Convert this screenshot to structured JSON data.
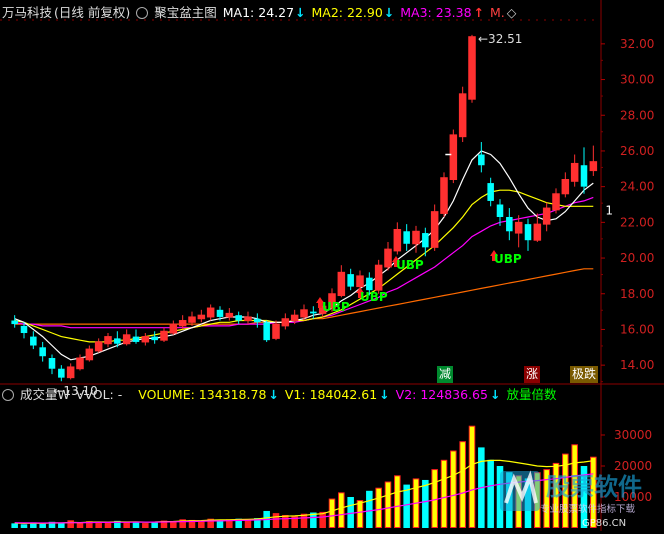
{
  "main_header": {
    "stock_name": "万马科技",
    "period": "(日线 前复权)",
    "indicator_name": "聚宝盆主图",
    "ma1_label": "MA1: 24.27",
    "ma2_label": "MA2: 22.90",
    "ma3_label": "MA3: 23.38",
    "m_label": "M.",
    "arrow_down": "↓",
    "arrow_up": "↑",
    "diamond": "◇",
    "colors": {
      "ma1": "#ffffff",
      "ma2": "#ffff00",
      "ma3": "#ff00ff",
      "m": "#ff4040"
    }
  },
  "volume_header": {
    "name": "成交量W",
    "vvol": "VVOL: -",
    "volume_label": "VOLUME: 134318.78",
    "v1_label": "V1: 184042.61",
    "v2_label": "V2: 124836.65",
    "extra": "放量倍数"
  },
  "annotations": {
    "high": "32.51",
    "low": "13.10",
    "arrow_left": "←",
    "dash": "1"
  },
  "signals": [
    "UBP",
    "UBP",
    "UBP",
    "UBP"
  ],
  "bar_labels": {
    "jian": "减",
    "zhang": "涨",
    "die": "极跌"
  },
  "watermark": {
    "title": "股票软件",
    "sub": "专业股票软件指标下载",
    "site": "GP86.CN"
  },
  "chart_data": {
    "type": "candlestick",
    "y_axis_ticks": [
      "32.00",
      "30.00",
      "28.00",
      "26.00",
      "24.00",
      "22.00",
      "20.00",
      "18.00",
      "16.00",
      "14.00"
    ],
    "ylim": [
      13.0,
      33.0
    ],
    "volume_ticks": [
      "30000",
      "20000",
      "10000"
    ],
    "volume_ylim": [
      0,
      40000
    ],
    "candles": [
      [
        16.5,
        16.3,
        16.8,
        16.1
      ],
      [
        16.2,
        15.8,
        16.4,
        15.5
      ],
      [
        15.6,
        15.1,
        15.9,
        14.9
      ],
      [
        15.0,
        14.5,
        15.3,
        14.2
      ],
      [
        14.4,
        13.8,
        14.6,
        13.5
      ],
      [
        13.8,
        13.3,
        14.0,
        13.1
      ],
      [
        13.3,
        13.9,
        14.1,
        13.2
      ],
      [
        13.8,
        14.4,
        14.6,
        13.7
      ],
      [
        14.3,
        14.9,
        15.1,
        14.2
      ],
      [
        14.8,
        15.3,
        15.5,
        14.7
      ],
      [
        15.2,
        15.6,
        15.8,
        15.0
      ],
      [
        15.5,
        15.2,
        15.9,
        15.0
      ],
      [
        15.2,
        15.7,
        16.0,
        15.1
      ],
      [
        15.6,
        15.3,
        16.0,
        15.2
      ],
      [
        15.3,
        15.6,
        15.8,
        15.1
      ],
      [
        15.6,
        15.4,
        15.9,
        15.2
      ],
      [
        15.4,
        15.9,
        16.1,
        15.3
      ],
      [
        15.8,
        16.3,
        16.5,
        15.7
      ],
      [
        16.2,
        16.5,
        16.8,
        16.0
      ],
      [
        16.4,
        16.7,
        17.0,
        16.2
      ],
      [
        16.6,
        16.8,
        17.1,
        16.4
      ],
      [
        16.7,
        17.2,
        17.4,
        16.5
      ],
      [
        17.1,
        16.7,
        17.3,
        16.5
      ],
      [
        16.7,
        16.9,
        17.2,
        16.5
      ],
      [
        16.8,
        16.5,
        17.0,
        16.3
      ],
      [
        16.5,
        16.7,
        17.0,
        16.3
      ],
      [
        16.6,
        16.4,
        16.9,
        16.1
      ],
      [
        16.4,
        15.4,
        16.5,
        15.3
      ],
      [
        15.5,
        16.3,
        16.5,
        15.4
      ],
      [
        16.2,
        16.6,
        16.9,
        16.0
      ],
      [
        16.5,
        16.8,
        17.1,
        16.3
      ],
      [
        16.7,
        17.1,
        17.4,
        16.5
      ],
      [
        17.0,
        16.9,
        17.3,
        16.6
      ],
      [
        16.9,
        17.3,
        17.6,
        16.7
      ],
      [
        17.2,
        18.0,
        18.3,
        17.0
      ],
      [
        17.9,
        19.2,
        19.6,
        17.8
      ],
      [
        19.1,
        18.4,
        19.4,
        18.2
      ],
      [
        18.4,
        19.0,
        19.3,
        18.1
      ],
      [
        18.9,
        18.2,
        19.2,
        17.9
      ],
      [
        18.2,
        19.6,
        19.9,
        18.0
      ],
      [
        19.5,
        20.5,
        20.9,
        19.3
      ],
      [
        20.4,
        21.6,
        22.0,
        20.2
      ],
      [
        21.5,
        20.8,
        21.9,
        20.4
      ],
      [
        20.8,
        21.5,
        21.8,
        20.3
      ],
      [
        21.4,
        20.6,
        21.7,
        20.1
      ],
      [
        20.6,
        22.6,
        23.0,
        20.4
      ],
      [
        22.5,
        24.5,
        24.8,
        22.3
      ],
      [
        24.4,
        26.9,
        27.2,
        24.2
      ],
      [
        26.8,
        29.2,
        29.6,
        26.5
      ],
      [
        28.9,
        32.4,
        32.5,
        28.7
      ],
      [
        25.8,
        25.2,
        26.5,
        24.8
      ],
      [
        24.2,
        23.2,
        24.5,
        22.9
      ],
      [
        23.0,
        22.3,
        23.3,
        21.8
      ],
      [
        22.3,
        21.5,
        22.8,
        21.0
      ],
      [
        21.4,
        22.0,
        22.4,
        20.6
      ],
      [
        21.9,
        21.0,
        22.2,
        20.4
      ],
      [
        21.0,
        21.9,
        22.5,
        20.9
      ],
      [
        21.9,
        22.8,
        23.1,
        21.5
      ],
      [
        22.7,
        23.6,
        23.9,
        22.5
      ],
      [
        23.6,
        24.4,
        24.8,
        23.4
      ],
      [
        24.3,
        25.3,
        25.8,
        24.0
      ],
      [
        25.2,
        24.0,
        26.2,
        23.6
      ],
      [
        24.9,
        25.4,
        26.3,
        24.6
      ]
    ],
    "ma1": [
      16.6,
      16.4,
      16.0,
      15.6,
      15.1,
      14.6,
      14.3,
      14.4,
      14.5,
      14.7,
      14.9,
      15.1,
      15.3,
      15.4,
      15.5,
      15.5,
      15.6,
      15.7,
      15.9,
      16.1,
      16.3,
      16.5,
      16.6,
      16.7,
      16.7,
      16.7,
      16.6,
      16.4,
      16.4,
      16.4,
      16.5,
      16.6,
      16.8,
      16.9,
      17.2,
      17.6,
      17.9,
      18.3,
      18.6,
      19.0,
      19.4,
      19.9,
      20.3,
      20.7,
      21.1,
      21.6,
      22.3,
      23.2,
      24.4,
      25.5,
      26.0,
      25.8,
      25.3,
      24.5,
      23.6,
      22.8,
      22.3,
      22.1,
      22.2,
      22.6,
      23.2,
      23.8,
      24.2
    ],
    "ma2": [
      16.5,
      16.4,
      16.2,
      16.0,
      15.8,
      15.6,
      15.5,
      15.4,
      15.3,
      15.3,
      15.3,
      15.4,
      15.4,
      15.5,
      15.6,
      15.7,
      15.8,
      15.9,
      16.0,
      16.1,
      16.2,
      16.3,
      16.4,
      16.4,
      16.5,
      16.5,
      16.5,
      16.5,
      16.4,
      16.4,
      16.5,
      16.5,
      16.6,
      16.7,
      16.9,
      17.1,
      17.4,
      17.7,
      18.0,
      18.3,
      18.7,
      19.1,
      19.5,
      19.9,
      20.3,
      20.7,
      21.2,
      21.7,
      22.3,
      23.0,
      23.4,
      23.7,
      23.8,
      23.8,
      23.7,
      23.5,
      23.3,
      23.1,
      23.0,
      22.9,
      22.9,
      22.9,
      22.9
    ],
    "ma3": [
      16.4,
      16.3,
      16.3,
      16.2,
      16.2,
      16.2,
      16.1,
      16.1,
      16.1,
      16.1,
      16.1,
      16.1,
      16.1,
      16.1,
      16.1,
      16.1,
      16.1,
      16.1,
      16.1,
      16.1,
      16.2,
      16.2,
      16.2,
      16.2,
      16.3,
      16.3,
      16.3,
      16.3,
      16.4,
      16.4,
      16.4,
      16.5,
      16.6,
      16.7,
      16.8,
      17.0,
      17.2,
      17.4,
      17.6,
      17.8,
      18.1,
      18.3,
      18.6,
      18.9,
      19.2,
      19.5,
      19.9,
      20.3,
      20.7,
      21.2,
      21.5,
      21.8,
      22.0,
      22.1,
      22.2,
      22.3,
      22.4,
      22.5,
      22.7,
      22.9,
      23.1,
      23.2,
      23.4
    ],
    "ma4": [
      16.3,
      16.3,
      16.3,
      16.3,
      16.3,
      16.3,
      16.3,
      16.3,
      16.3,
      16.3,
      16.3,
      16.3,
      16.3,
      16.3,
      16.3,
      16.3,
      16.3,
      16.3,
      16.3,
      16.3,
      16.3,
      16.3,
      16.3,
      16.3,
      16.3,
      16.3,
      16.4,
      16.4,
      16.4,
      16.4,
      16.5,
      16.5,
      16.6,
      16.6,
      16.7,
      16.8,
      16.9,
      17.0,
      17.1,
      17.2,
      17.3,
      17.4,
      17.5,
      17.6,
      17.7,
      17.8,
      17.9,
      18.0,
      18.1,
      18.2,
      18.3,
      18.4,
      18.5,
      18.6,
      18.7,
      18.8,
      18.9,
      19.0,
      19.1,
      19.2,
      19.3,
      19.4,
      19.4
    ],
    "volumes": [
      1500,
      1200,
      1800,
      1400,
      2000,
      1600,
      2500,
      1800,
      2200,
      2000,
      1700,
      2300,
      1900,
      2100,
      1600,
      2000,
      2400,
      2200,
      2800,
      2600,
      2400,
      3000,
      2600,
      2800,
      3000,
      2800,
      3200,
      5500,
      4800,
      4200,
      3800,
      4600,
      5000,
      5200,
      9500,
      11500,
      10000,
      9000,
      12000,
      13000,
      15000,
      17000,
      14000,
      16000,
      15500,
      19000,
      22000,
      25000,
      28000,
      33000,
      26000,
      22000,
      20000,
      18000,
      17000,
      16000,
      18000,
      19000,
      21000,
      24000,
      27000,
      20000,
      23000
    ],
    "vol_ma1": [
      1600,
      1500,
      1550,
      1500,
      1650,
      1600,
      1800,
      1750,
      1900,
      1950,
      1900,
      2000,
      1950,
      2000,
      1900,
      1950,
      2050,
      2100,
      2250,
      2350,
      2400,
      2550,
      2600,
      2650,
      2750,
      2800,
      2900,
      3300,
      3600,
      3800,
      3900,
      4100,
      4400,
      4600,
      5500,
      6500,
      7300,
      8000,
      8800,
      9700,
      10600,
      11600,
      12200,
      13000,
      13700,
      14700,
      15800,
      17000,
      18500,
      20500,
      21500,
      21800,
      21800,
      21500,
      21000,
      20500,
      20000,
      19800,
      19900,
      20300,
      21000,
      21300,
      21700
    ],
    "vol_ma2": [
      1700,
      1650,
      1650,
      1600,
      1650,
      1650,
      1700,
      1700,
      1750,
      1800,
      1800,
      1850,
      1850,
      1900,
      1900,
      1900,
      1950,
      2000,
      2050,
      2100,
      2150,
      2250,
      2300,
      2350,
      2450,
      2500,
      2600,
      2750,
      2900,
      3000,
      3100,
      3250,
      3400,
      3550,
      3900,
      4300,
      4700,
      5100,
      5500,
      5950,
      6450,
      7000,
      7500,
      8000,
      8500,
      9100,
      9800,
      10500,
      11300,
      12300,
      13000,
      13600,
      14100,
      14500,
      14800,
      15100,
      15300,
      15600,
      15900,
      16300,
      16800,
      17100,
      17500
    ]
  }
}
